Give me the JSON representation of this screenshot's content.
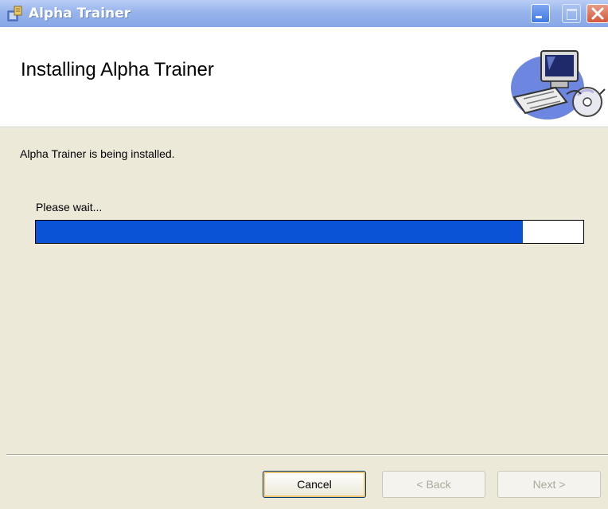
{
  "window": {
    "title": "Alpha Trainer",
    "controls": [
      "minimize",
      "maximize",
      "close"
    ]
  },
  "header": {
    "title": "Installing Alpha Trainer",
    "art_icon": "computer-cd-icon"
  },
  "main": {
    "status_text": "Alpha Trainer is being installed.",
    "progress_label": "Please wait...",
    "progress_fraction": 0.89
  },
  "footer": {
    "cancel_label": "Cancel",
    "back_label": "< Back",
    "next_label": "Next >"
  },
  "colors": {
    "titlebar": "#98b4ec",
    "progress_fill": "#0a52d6",
    "dialog_bg": "#ece9d8"
  }
}
